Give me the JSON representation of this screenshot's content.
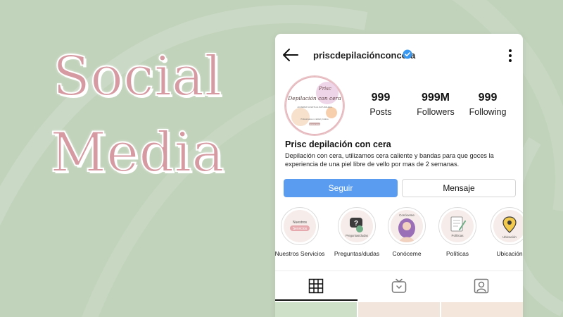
{
  "headline": {
    "line1": "Social",
    "line2": "Media"
  },
  "profile": {
    "username": "priscdepilaciónconcera",
    "avatar": {
      "script_title": "Prisc",
      "script_subtitle": "Depilación con cera",
      "tagline": "ACUERDA SU ESTA AL NATURALEZA",
      "small_text": "Profesionales en calidad y belleza",
      "button_text": "Reservar ahora"
    },
    "stats": {
      "posts": {
        "value": "999",
        "label": "Posts"
      },
      "followers": {
        "value": "999M",
        "label": "Followers"
      },
      "following": {
        "value": "999",
        "label": "Following"
      }
    },
    "name": "Prisc depilación con cera",
    "bio": "Depilación con cera, utilizamos cera caliente y bandas para que goces la experiencia de una piel libre de vello por mas de 2 semanas."
  },
  "buttons": {
    "follow": "Seguir",
    "message": "Mensaje"
  },
  "highlights": [
    {
      "label": "Nuestros Servicios",
      "inner_top": "Nuestros",
      "inner_bottom": "Servicios"
    },
    {
      "label": "Preguntas/dudas",
      "inner_bottom": "Preguntas/dudas"
    },
    {
      "label": "Conóceme",
      "inner_top": "Conóceme"
    },
    {
      "label": "Políticas",
      "inner_bottom": "Políticas"
    },
    {
      "label": "Ubicación",
      "inner_bottom": "Ubicación"
    }
  ],
  "icons": {
    "back": "arrow-left-icon",
    "verified": "verified-badge-icon",
    "more": "more-vertical-icon",
    "grid": "grid-icon",
    "igtv": "igtv-icon",
    "tagged": "tagged-user-icon"
  },
  "colors": {
    "background": "#c2d3bb",
    "headline": "#d69aa2",
    "follow_button": "#5a9cf0",
    "verified": "#3897f0"
  }
}
